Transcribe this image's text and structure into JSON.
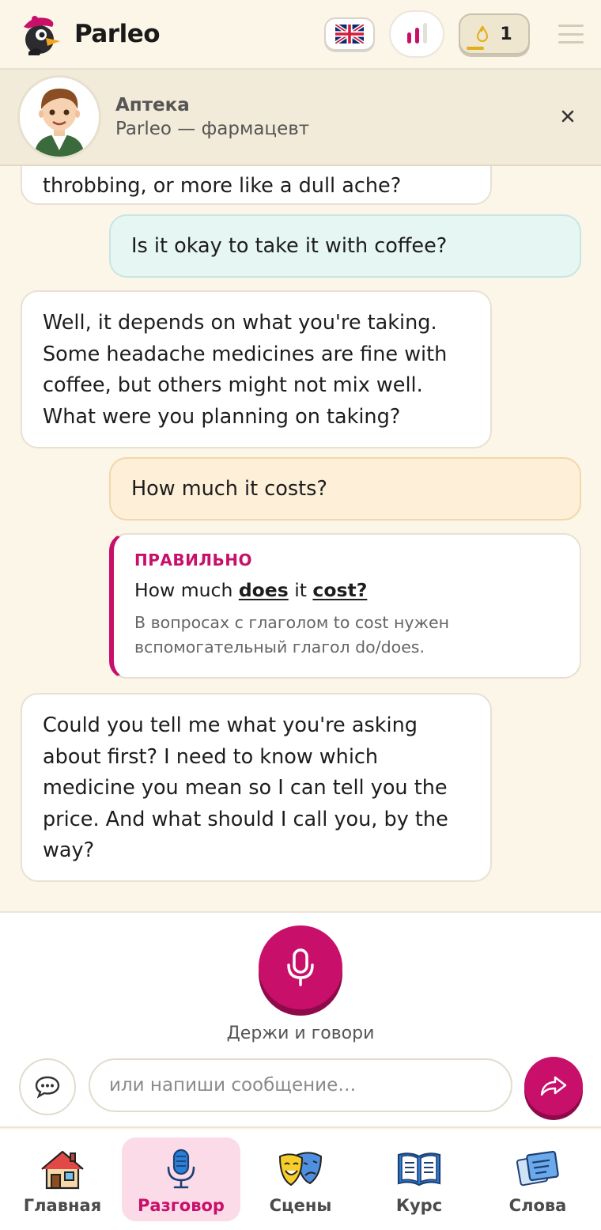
{
  "app": {
    "name": "Parleo"
  },
  "header": {
    "streak_count": "1",
    "flag_icon": "uk-flag-icon",
    "level_icon": "level-bars-icon",
    "streak_icon": "flame-icon",
    "streak_progress": 0.3
  },
  "scenario": {
    "title": "Аптека",
    "subtitle": "Parleo — фармацевт"
  },
  "messages": [
    {
      "role": "bot",
      "text": "throbbing, or more like a dull ache?"
    },
    {
      "role": "user",
      "text": "Is it okay to take it with coffee?"
    },
    {
      "role": "bot",
      "text": "Well, it depends on what you're taking. Some headache medicines are fine with coffee, but others might not mix well. What were you planning on taking?"
    },
    {
      "role": "user",
      "text": "How much it costs?"
    },
    {
      "role": "bot",
      "text": "Could you tell me what you're asking about first? I need to know which medicine you mean so I can tell you the price. And what should I call you, by the way?"
    }
  ],
  "correction": {
    "label": "ПРАВИЛЬНО",
    "parts": [
      "How much ",
      "does",
      " it ",
      "cost?"
    ],
    "note": "В вопросах с глаголом to cost нужен вспомогательный глагол do/does."
  },
  "voice": {
    "hold_label": "Держи и говори",
    "input_placeholder": "или напиши сообщение…"
  },
  "nav": {
    "items": [
      {
        "label": "Главная",
        "icon": "house-icon"
      },
      {
        "label": "Разговор",
        "icon": "microphone-icon",
        "active": true
      },
      {
        "label": "Сцены",
        "icon": "theater-masks-icon"
      },
      {
        "label": "Курс",
        "icon": "open-book-icon"
      },
      {
        "label": "Слова",
        "icon": "word-cards-icon"
      }
    ]
  },
  "colors": {
    "accent": "#c8106b",
    "background": "#fcf6e9",
    "user_bubble": "#e6f6f3",
    "error_bubble": "#fdefd8"
  }
}
